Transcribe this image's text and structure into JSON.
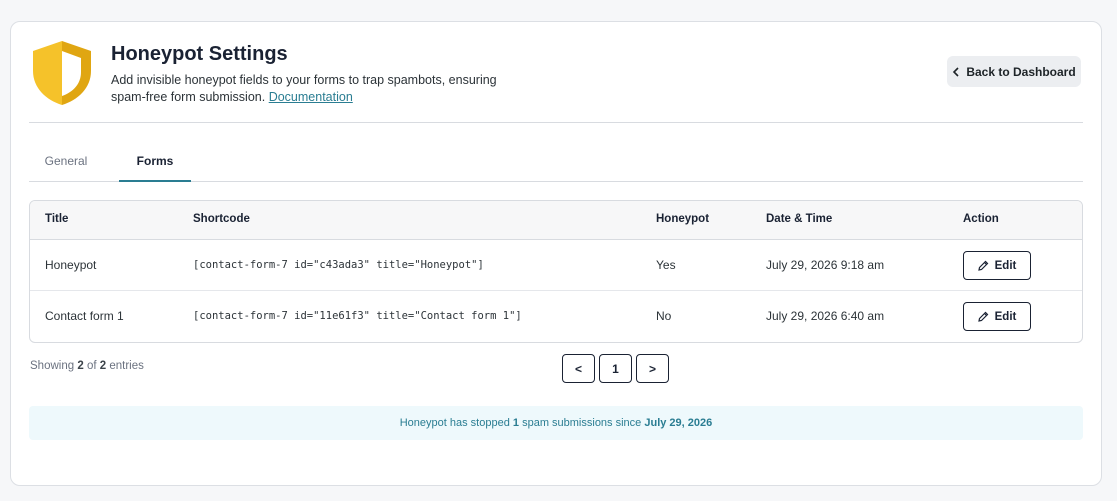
{
  "header": {
    "title": "Honeypot Settings",
    "description": "Add invisible honeypot fields to your forms to trap spambots, ensuring spam-free form submission.",
    "doc_link": "Documentation",
    "back_button": "Back to Dashboard"
  },
  "tabs": [
    {
      "label": "General",
      "active": false
    },
    {
      "label": "Forms",
      "active": true
    }
  ],
  "table": {
    "columns": [
      "Title",
      "Shortcode",
      "Honeypot",
      "Date & Time",
      "Action"
    ],
    "rows": [
      {
        "title": "Honeypot",
        "shortcode": "[contact-form-7 id=\"c43ada3\" title=\"Honeypot\"]",
        "honeypot": "Yes",
        "datetime": "July 29, 2026 9:18 am",
        "action": "Edit"
      },
      {
        "title": "Contact form 1",
        "shortcode": "[contact-form-7 id=\"11e61f3\" title=\"Contact form 1\"]",
        "honeypot": "No",
        "datetime": "July 29, 2026 6:40 am",
        "action": "Edit"
      }
    ]
  },
  "pagination": {
    "showing_prefix": "Showing",
    "shown": "2",
    "of": "of",
    "total": "2",
    "entries": "entries",
    "prev": "<",
    "page": "1",
    "next": ">"
  },
  "notice": {
    "prefix": "Honeypot has stopped",
    "count": "1",
    "middle": "spam submissions since",
    "date": "July 29, 2026"
  },
  "colors": {
    "accent": "#2a7d92",
    "shield": "#f0b81b",
    "notice_bg": "#eef9fc"
  }
}
